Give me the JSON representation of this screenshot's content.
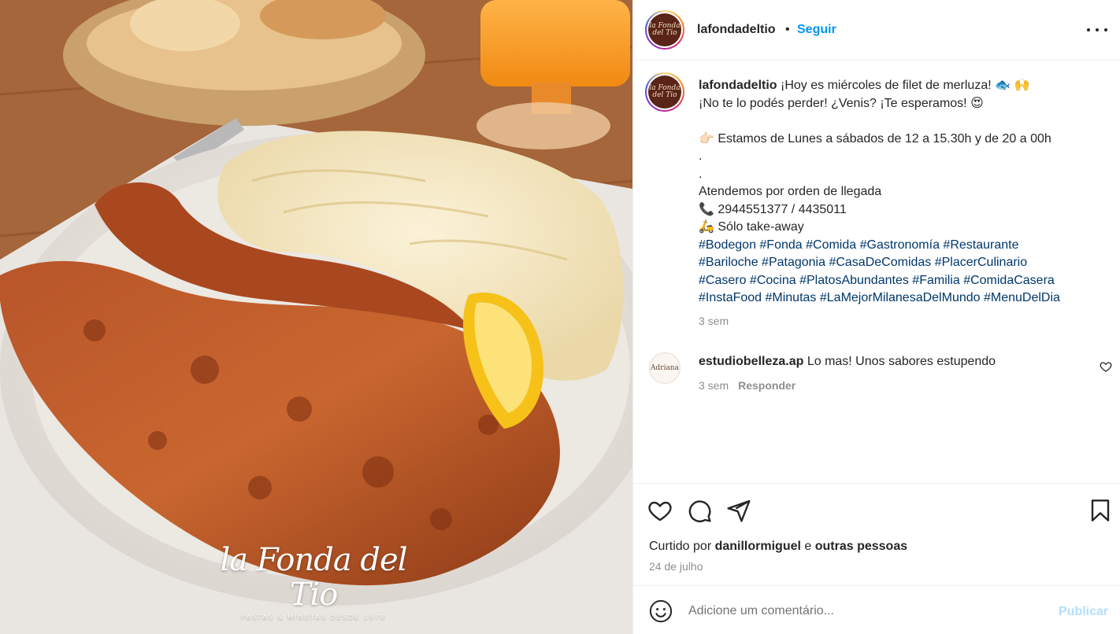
{
  "photo": {
    "watermark_logo": "la Fonda del Tio",
    "watermark_tagline": "PASTAS & MINUTAS DESDE 1978"
  },
  "header": {
    "avatar_text": "la Fonda del Tio",
    "username": "lafondadeltio",
    "separator": "•",
    "follow_label": "Seguir"
  },
  "caption": {
    "username": "lafondadeltio",
    "first_line": " ¡Hoy es miércoles de filet de merluza! 🐟 🙌",
    "lines": [
      "¡No te lo podés perder! ¿Venis? ¡Te esperamos! 😍",
      " ",
      "👉🏻 Estamos de Lunes a sábados de 12 a 15.30h y de 20 a 00h",
      ".",
      ".",
      "Atendemos por orden de llegada",
      "📞 2944551377 / 4435011",
      "🛵 Sólo take-away"
    ],
    "hashtags": [
      "#Bodegon #Fonda #Comida #Gastronomía #Restaurante",
      "#Bariloche #Patagonia #CasaDeComidas #PlacerCulinario",
      "#Casero #Cocina #PlatosAbundantes #Familia #ComidaCasera",
      "#InstaFood #Minutas #LaMejorMilanesaDelMundo #MenuDelDia"
    ],
    "time": "3 sem"
  },
  "comment": {
    "avatar_text": "Adriana",
    "username": "estudiobelleza.ap",
    "text": " Lo mas! Unos sabores estupendo",
    "time": "3 sem",
    "reply_label": "Responder"
  },
  "actions": {
    "liked_prefix": "Curtido por ",
    "liked_user": "danillormiguel",
    "liked_middle": " e ",
    "liked_others": "outras pessoas",
    "date": "24 de julho"
  },
  "add_comment": {
    "placeholder": "Adicione um comentário...",
    "publish_label": "Publicar"
  }
}
